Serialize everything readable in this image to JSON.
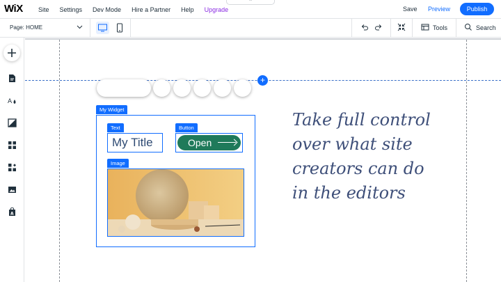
{
  "topbar": {
    "logo": "WiX",
    "menu": [
      "Site",
      "Settings",
      "Dev Mode",
      "Hire a Partner",
      "Help"
    ],
    "upgrade": "Upgrade",
    "collapse_glyph": "⌃",
    "save": "Save",
    "preview": "Preview",
    "publish": "Publish",
    "accent": "#116dff"
  },
  "toolbar": {
    "page_prefix": "Page:",
    "page_name": "HOME",
    "tools": "Tools",
    "search": "Search"
  },
  "rail": {
    "items": [
      "add",
      "pages",
      "theme",
      "background",
      "apps",
      "interactions",
      "media",
      "app-market"
    ]
  },
  "canvas": {
    "add_section_glyph": "+",
    "widget_tag": "My Widget",
    "text_tag": "Text",
    "button_tag": "Button",
    "image_tag": "Image",
    "title_text": "My Title",
    "button_text": "Open",
    "button_color": "#1f7a5a",
    "hero_lines": [
      "Take full control",
      "over what site",
      "creators can do",
      "in the editors"
    ]
  }
}
